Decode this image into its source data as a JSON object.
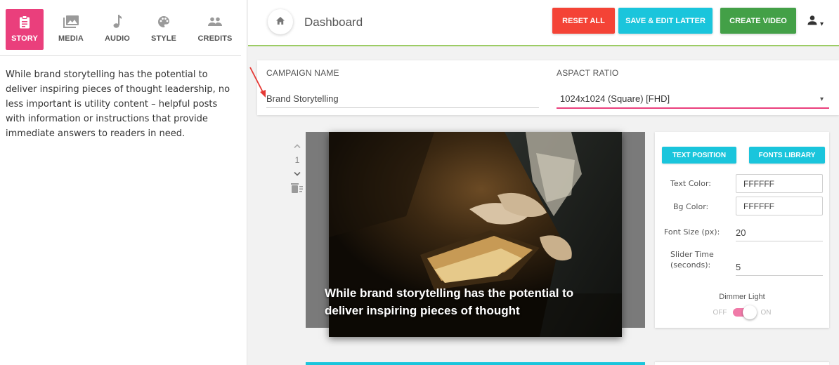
{
  "sidebar": {
    "tabs": [
      {
        "label": "STORY",
        "icon": "clipboard-icon",
        "active": true
      },
      {
        "label": "MEDIA",
        "icon": "image-icon",
        "active": false
      },
      {
        "label": "AUDIO",
        "icon": "music-note-icon",
        "active": false
      },
      {
        "label": "STYLE",
        "icon": "palette-icon",
        "active": false
      },
      {
        "label": "CREDITS",
        "icon": "people-icon",
        "active": false
      }
    ],
    "story_text": "While brand storytelling has the potential to deliver inspiring pieces of thought leadership, no less important is utility content – helpful posts with information or instructions that provide immediate answers to readers in need."
  },
  "header": {
    "title": "Dashboard",
    "reset_label": "RESET ALL",
    "save_label": "SAVE & EDIT LATTER",
    "create_label": "CREATE VIDEO",
    "user_caret": "▾"
  },
  "campaign": {
    "name_label": "CAMPAIGN NAME",
    "name_value": "Brand Storytelling",
    "ratio_label": "ASPACT RATIO",
    "ratio_value": "1024x1024 (Square) [FHD]",
    "ratio_caret": "▾"
  },
  "slide": {
    "number": "1",
    "caption": "While brand storytelling has the potential to deliver inspiring pieces of thought"
  },
  "settings": {
    "text_position_label": "TEXT POSITION",
    "fonts_library_label": "FONTS LIBRARY",
    "text_color_label": "Text Color:",
    "text_color_value": "FFFFFF",
    "bg_color_label": "Bg Color:",
    "bg_color_value": "FFFFFF",
    "font_size_label": "Font Size (px):",
    "font_size_value": "20",
    "slider_time_label_1": "Slider Time",
    "slider_time_label_2": "(seconds):",
    "slider_time_value": "5",
    "dimmer_label": "Dimmer Light",
    "off_label": "OFF",
    "on_label": "ON"
  },
  "colors": {
    "accent_pink": "#ea3f7c",
    "reset_red": "#f44336",
    "save_cyan": "#1ac5dc",
    "create_green": "#43a047",
    "header_border_green": "#9ccc65"
  }
}
